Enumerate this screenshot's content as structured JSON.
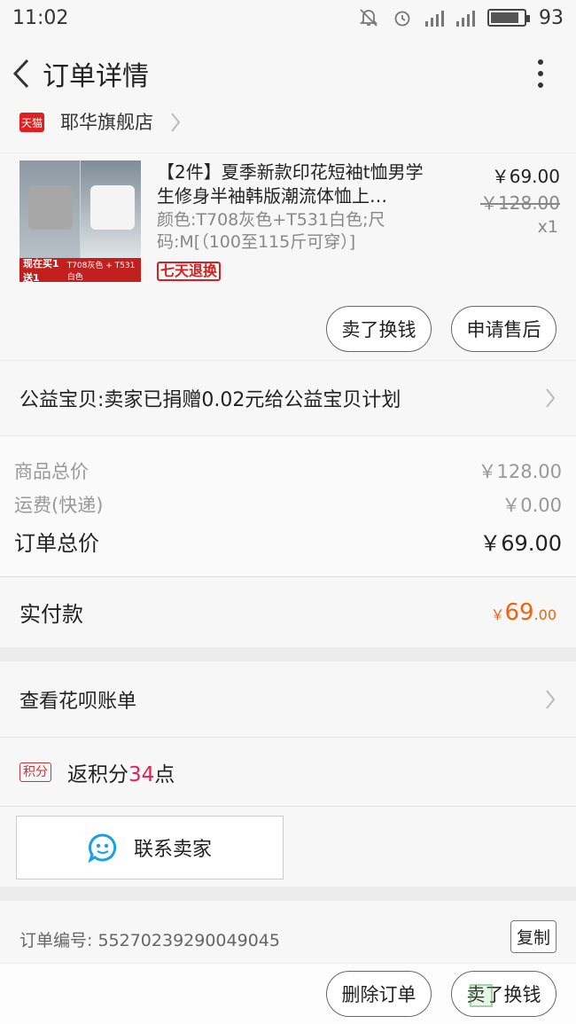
{
  "status_bar": {
    "time": "11:02",
    "battery": "93",
    "battery_level": 0.85
  },
  "nav": {
    "title": "订单详情"
  },
  "shop": {
    "badge": "天猫",
    "name": "耶华旗舰店"
  },
  "product": {
    "title": "【2件】夏季新款印花短袖t恤男学生修身半袖韩版潮流体恤上…",
    "sku": "颜色:T708灰色+T531白色;尺码:M[（100至115斤可穿）]",
    "price": "￥69.00",
    "original_price": "￥128.00",
    "quantity": "x1",
    "return_tag": "七天退换",
    "thumb_banner": "现在买1送1",
    "thumb_note": "T708灰色 + T531白色"
  },
  "actions": {
    "sell_exchange": "卖了换钱",
    "after_sale": "申请售后"
  },
  "charity": {
    "label": "公益宝贝:卖家已捐赠0.02元给公益宝贝计划"
  },
  "summary": {
    "goods_label": "商品总价",
    "goods_value": "￥128.00",
    "shipping_label": "运费(快递)",
    "shipping_value": "￥0.00",
    "total_label": "订单总价",
    "total_value": "￥69.00"
  },
  "paid": {
    "label": "实付款",
    "currency": "￥",
    "integer": "69",
    "decimal": ".00"
  },
  "huabei": {
    "label": "查看花呗账单"
  },
  "points": {
    "badge": "积分",
    "prefix": "返积分",
    "value": "34",
    "suffix": "点"
  },
  "contact": {
    "label": "联系卖家"
  },
  "order": {
    "number_label": "订单编号:",
    "number": "55270239290049045",
    "copy": "复制"
  },
  "bottom": {
    "delete": "删除订单",
    "sell_exchange": "卖了换钱"
  }
}
